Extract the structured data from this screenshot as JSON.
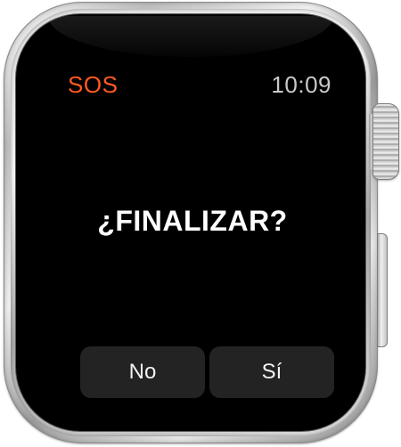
{
  "status_bar": {
    "title": "SOS",
    "time": "10:09"
  },
  "dialog": {
    "prompt": "¿FINALIZAR?"
  },
  "buttons": {
    "no_label": "No",
    "yes_label": "Sí"
  },
  "colors": {
    "accent": "#ff5a1f",
    "screen_background": "#000000",
    "button_background": "#232323",
    "time_text": "#c9c9c9"
  },
  "device": {
    "hardware_controls": [
      "digital-crown-icon",
      "side-button-icon"
    ]
  }
}
